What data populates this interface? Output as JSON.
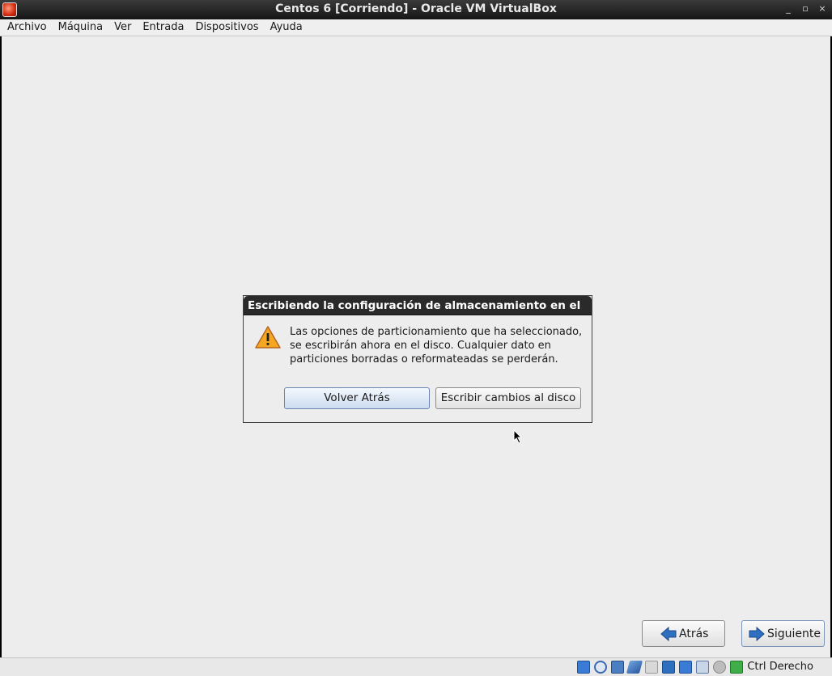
{
  "window": {
    "title": "Centos 6 [Corriendo] - Oracle VM VirtualBox",
    "controls": [
      "_",
      "▫",
      "×"
    ]
  },
  "menubar": {
    "items": [
      "Archivo",
      "Máquina",
      "Ver",
      "Entrada",
      "Dispositivos",
      "Ayuda"
    ]
  },
  "dialog": {
    "title": "Escribiendo la configuración de almacenamiento en el",
    "message_lines": [
      "Las opciones de particionamiento que ha seleccionado,",
      "se escribirán ahora en el disco.  Cualquier dato en",
      "particiones borradas o reformateadas se perderán."
    ],
    "back_button": "Volver Atrás",
    "write_button": "Escribir cambios al disco",
    "icon": "warning-icon"
  },
  "nav": {
    "back_label": "Atrás",
    "next_label": "Siguiente"
  },
  "statusbar": {
    "icons": [
      "hard-disk-icon",
      "optical-drive-icon",
      "network-icon",
      "usb-icon",
      "shared-folders-icon",
      "display-icon",
      "video-capture-icon",
      "virtualization-icon",
      "mouse-integration-icon",
      "host-key-icon"
    ],
    "host_key": "Ctrl Derecho"
  },
  "colors": {
    "titlebar": "#222222",
    "vm_background": "#ededed",
    "primary_button": "#cddcef",
    "warning": "#f5a623"
  }
}
